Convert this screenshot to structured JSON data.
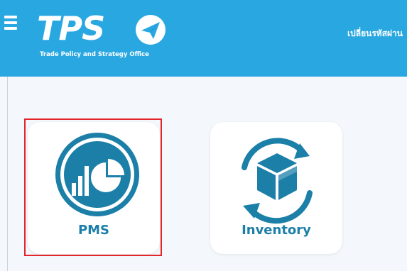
{
  "header": {
    "logo_text": "TPS",
    "logo_subtitle": "Trade Policy and Strategy Office",
    "change_password_label": "เปลี่ยนรหัสผ่าน"
  },
  "apps": [
    {
      "label": "PMS",
      "icon": "pie-bar-chart-icon",
      "selected": true
    },
    {
      "label": "Inventory",
      "icon": "box-refresh-icon",
      "selected": false
    }
  ],
  "colors": {
    "header_bg": "#29a7e1",
    "icon_teal": "#1b7fa8",
    "highlight_border": "#e3252b",
    "page_bg": "#f4f7fb"
  }
}
